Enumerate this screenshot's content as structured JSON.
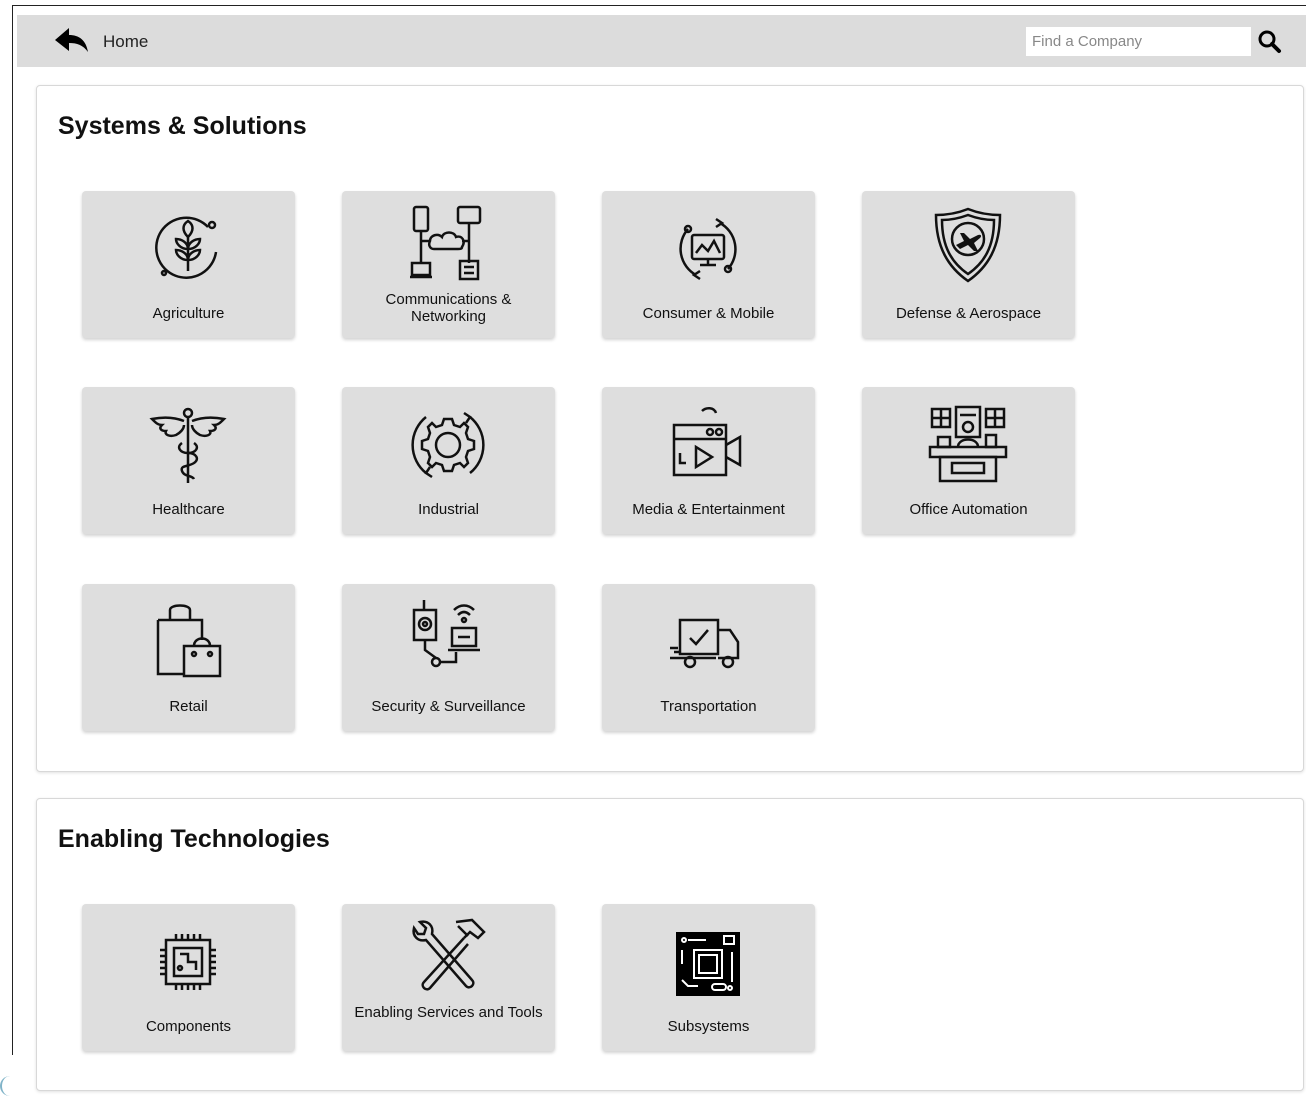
{
  "topbar": {
    "home_label": "Home",
    "search_placeholder": "Find a Company",
    "back_icon": "back-arrow-icon",
    "search_icon": "search-icon"
  },
  "sections": [
    {
      "title": "Systems & Solutions",
      "tiles": [
        {
          "label": "Agriculture",
          "icon": "agriculture-icon"
        },
        {
          "label": "Communications & Networking",
          "icon": "network-icon"
        },
        {
          "label": "Consumer & Mobile",
          "icon": "consumer-mobile-icon"
        },
        {
          "label": "Defense & Aerospace",
          "icon": "shield-plane-icon"
        },
        {
          "label": "Healthcare",
          "icon": "caduceus-icon"
        },
        {
          "label": "Industrial",
          "icon": "gear-icon"
        },
        {
          "label": "Media & Entertainment",
          "icon": "video-camera-icon"
        },
        {
          "label": "Office Automation",
          "icon": "office-desk-icon"
        },
        {
          "label": "Retail",
          "icon": "shopping-bags-icon"
        },
        {
          "label": "Security & Surveillance",
          "icon": "security-camera-icon"
        },
        {
          "label": "Transportation",
          "icon": "delivery-truck-icon"
        }
      ]
    },
    {
      "title": "Enabling Technologies",
      "tiles": [
        {
          "label": "Components",
          "icon": "chip-icon"
        },
        {
          "label": "Enabling Services and Tools",
          "icon": "wrench-hammer-icon"
        },
        {
          "label": "Subsystems",
          "icon": "circuit-board-icon"
        }
      ]
    }
  ],
  "colors": {
    "topbar_bg": "#dcdcdc",
    "tile_bg": "#dedede",
    "panel_border": "#d8d8d8"
  }
}
